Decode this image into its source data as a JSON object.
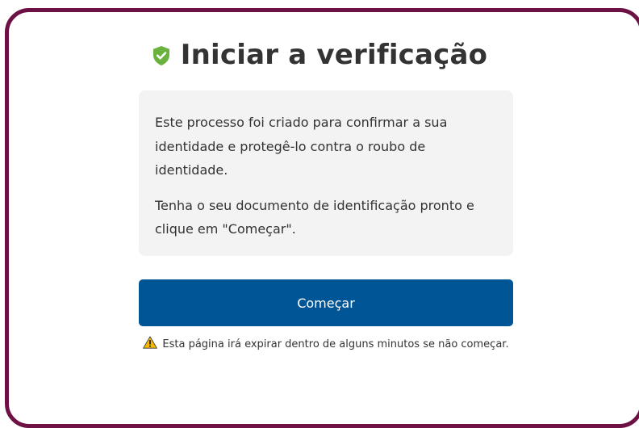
{
  "header": {
    "title": "Iniciar a verificação",
    "icon": "shield-check-icon",
    "icon_color": "#6ab23e"
  },
  "info": {
    "paragraph1": "Este processo foi criado para confirmar a sua identidade e protegê-lo contra o roubo de identidade.",
    "paragraph2": "Tenha o seu documento de identificação pronto e clique em \"Começar\"."
  },
  "actions": {
    "start_label": "Começar",
    "button_color": "#005596"
  },
  "warning": {
    "icon": "warning-triangle-icon",
    "icon_color": "#f5b800",
    "text": "Esta página irá expirar dentro de alguns minutos se não começar."
  },
  "theme": {
    "frame_border": "#6d1144",
    "info_background": "#f3f3f3"
  }
}
